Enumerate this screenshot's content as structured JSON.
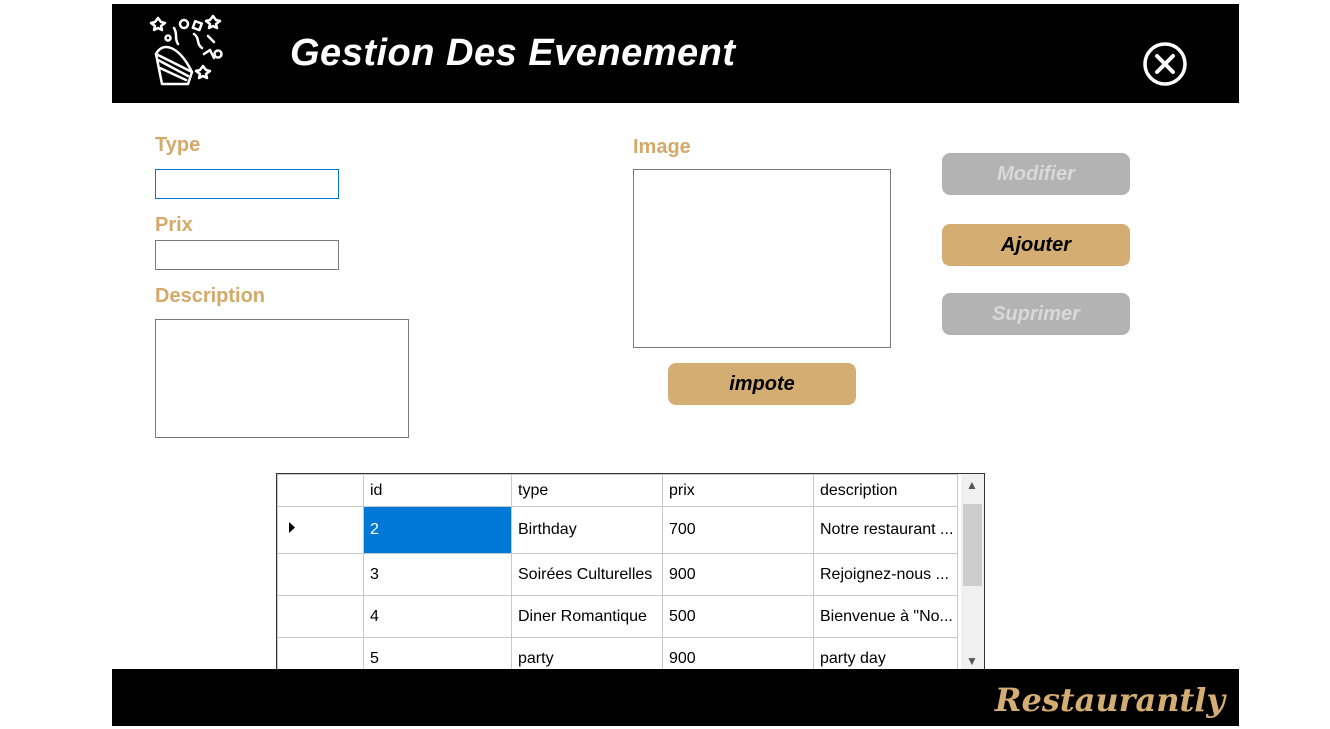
{
  "header": {
    "title": "Gestion Des Evenement"
  },
  "form": {
    "type_label": "Type",
    "type_value": "",
    "prix_label": "Prix",
    "prix_value": "",
    "description_label": "Description",
    "description_value": "",
    "image_label": "Image"
  },
  "buttons": {
    "modifier": "Modifier",
    "ajouter": "Ajouter",
    "suprimer": "Suprimer",
    "impote": "impote"
  },
  "table": {
    "columns": [
      "id",
      "type",
      "prix",
      "description"
    ],
    "rows": [
      [
        "2",
        "Birthday",
        "700",
        "Notre restaurant ..."
      ],
      [
        "3",
        "Soirées Culturelles",
        "900",
        " Rejoignez-nous ..."
      ],
      [
        "4",
        "Diner Romantique",
        "500",
        "Bienvenue à \"No..."
      ],
      [
        "5",
        "party",
        "900",
        "party day"
      ]
    ]
  },
  "footer": {
    "brand": "Restaurantly"
  },
  "colors": {
    "accent": "#d4ad72",
    "header_bg": "#000000",
    "selection": "#0078d7",
    "disabled": "#b3b3b3"
  },
  "icons": {
    "logo": "party-popper-icon",
    "close": "close-circle-icon"
  }
}
